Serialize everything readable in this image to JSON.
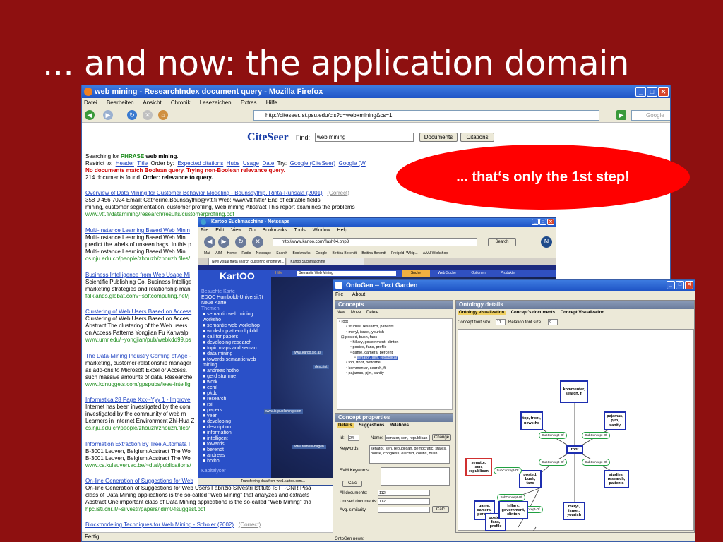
{
  "slide": {
    "title": "... and now: the application domain"
  },
  "callout": {
    "text": "... that‘s only the 1st step!"
  },
  "firefox": {
    "title": "web mining - ResearchIndex document query - Mozilla Firefox",
    "menu": [
      "Datei",
      "Bearbeiten",
      "Ansicht",
      "Chronik",
      "Lesezeichen",
      "Extras",
      "Hilfe"
    ],
    "url": "http://citeseer.ist.psu.edu/cis?q=web+mining&cs=1",
    "search_placeholder": "Google",
    "status": "Fertig"
  },
  "citeseer": {
    "logo": "CiteSeer",
    "find_label": "Find:",
    "query": "web mining",
    "documents_btn": "Documents",
    "citations_btn": "Citations",
    "search_prefix": "Searching for",
    "search_phrase": "PHRASE",
    "search_query": "web mining",
    "restrict": {
      "label": "Restrict to:",
      "links": [
        "Header",
        "Title"
      ],
      "order_label": "Order by:",
      "order_links": [
        "Expected citations",
        "Hubs",
        "Usage",
        "Date"
      ],
      "try_label": "Try:",
      "try_links": [
        "Google (CiteSeer)",
        "Google (W"
      ]
    },
    "no_docs": "No documents match Boolean query. Trying non-Boolean relevance query.",
    "found": "214 documents found.",
    "found_order": "Order: relevance to query.",
    "results": [
      {
        "title": "Overview of Data Mining for Customer Behavior Modeling - Bounsaythip, Rinta-Runsala (2001)",
        "correct": "(Correct)",
        "lines": [
          "358 9 456 7024 Email: Catherine.Bounsaythip@vtt.fi Web: www.vtt.fi/tte/ End of editable fields",
          "mining, customer segmentation, customer profiling, Web mining Abstract This report examines the problems"
        ],
        "url": "www.vtt.fi/datamining/research/results/customerprofiling.pdf"
      },
      {
        "title": "Multi-Instance Learning Based Web Minin",
        "lines": [
          "Multi-Instance Learning Based Web Mini",
          "predict the labels of unseen bags. In this p",
          "Multi-Instance Learning Based Web Mini"
        ],
        "url": "cs.nju.edu.cn/people/zhouzh/zhouzh.files/"
      },
      {
        "title": "Business Intelligence from Web Usage Mi",
        "lines": [
          "Scientific Publishing Co. Business Intellige",
          "marketing strategies and relationship man"
        ],
        "url": "falklands.globat.com/~softcomputing.net/j"
      },
      {
        "title": "Clustering of Web Users Based on Access",
        "lines": [
          "Clustering of Web Users Based on Acces",
          "Abstract The clustering of the Web users",
          "on Access Patterns Yongjian Fu Kanwalp"
        ],
        "url": "www.umr.edu/~yongjian/pub/webkdd99.ps"
      },
      {
        "title": "The Data-Mining Industry Coming of Age -",
        "lines": [
          "marketing, customer-relationship manager",
          "as add-ons to Microsoft Excel or Access.",
          "such massive amounts of data. Researche"
        ],
        "url": "www.kdnuggets.com/gpspubs/ieee-intellig"
      },
      {
        "title": "Informatica 28 Page Xxx--Yyy 1 - Improve",
        "lines": [
          "Internet has been investigated by the comi",
          "investigated by the community of web m",
          "Learners in Internet Environment Zhi-Hua Z"
        ],
        "url": "cs.nju.edu.cn/people/zhouzh/zhouzh.files/"
      },
      {
        "title": "Information Extraction By Tree Automata I",
        "lines": [
          "B-3001 Leuven, Belgium Abstract The Wo",
          "B-3001 Leuven, Belgium Abstract The Wo"
        ],
        "url": "www.cs.kuleuven.ac.be/~dtai/publications/"
      },
      {
        "title": "On-line Generation of Suggestions for Web",
        "lines": [
          "On-line Generation of Suggestions for Web Users Fabrizio Silvestri Istituto ISTI -CNR Pisa",
          "class of Data Mining applications is the so-called \"Web Mining\" that analyzes and extracts",
          "Abstract One important class of Data Mining applications is the so-called \"Web Mining\" tha"
        ],
        "url": "hpc.isti.cnr.it/~silvestr/papers/jdim04suggest.pdf"
      },
      {
        "title": "Blockmodeling Techniques for Web Mining - Schoier (2002)",
        "correct": "(Correct)",
        "lines": [],
        "url": ""
      }
    ]
  },
  "netscape": {
    "title": "Kartoo Suchmaschine - Netscape",
    "menu": [
      "File",
      "Edit",
      "View",
      "Go",
      "Bookmarks",
      "Tools",
      "Window",
      "Help"
    ],
    "url": "http://www.kartoo.com/flash04.php3",
    "search_btn": "Search",
    "bookmarks": [
      "Mail",
      "AIM",
      "Home",
      "Radio",
      "Netscape",
      "Search",
      "Bookmarks",
      "Google",
      "Bettina Berendt",
      "Bettina Berendt",
      "Freigeld -Wikip...",
      "AAAI Workshop"
    ],
    "tabs": [
      "New visual meta search clustering engine wi...",
      "Kartoo Suchmaschine"
    ],
    "logo": "KartOO",
    "kar_tabs": [
      "Hilfe",
      "Semantic Web Mining",
      "Suche",
      "Web Suche",
      "Optionen",
      "Produkte"
    ],
    "side_header": "Besuchte Karte",
    "side_items_top": [
      "EDOC Humboldt-Universit?t",
      "Neue Karte"
    ],
    "themen": "Themen",
    "topics": [
      "semantic web mining worksho",
      "semantic web workshop",
      "workshop at ecml pkdd",
      "call for papers",
      "developing research",
      "topic maps and seman",
      "data mining",
      "towards semantic web mining",
      "andreas hotho",
      "gerd stumme",
      "work",
      "ecml",
      "pkdd",
      "research",
      "rsil",
      "papers",
      "year",
      "developing",
      "description",
      "information",
      "intelligent",
      "towards",
      "berendt",
      "andreas",
      "hotho"
    ],
    "kapital": "Kapitalyser",
    "status": "Transferring data from ww1.kartoo.com...",
    "map_labels": [
      "www.karoo.sig.as",
      "descript",
      "www.fernuni-hagen.",
      "www.is-publishing.com"
    ]
  },
  "ontogen": {
    "title": "OntoGen -- Text Garden",
    "menu": [
      "File",
      "About"
    ],
    "concepts": {
      "header": "Concepts",
      "toolbar": [
        "New",
        "Move",
        "Delete"
      ],
      "tree": [
        "root",
        "studies, research, patients",
        "meryl, israel, yourish",
        "posted, bush, fans",
        "hillary, government, clinton",
        "posted, fans, profile",
        "game, camera, percent",
        "senator, sen, republican",
        "top, front, newsthe",
        "kommentar, search, fi",
        "pajamas, pjm, sanity"
      ]
    },
    "props": {
      "header": "Concept properties",
      "tabs": [
        "Details",
        "Suggestions",
        "Relations"
      ],
      "id_label": "Id:",
      "id": "24",
      "name_label": "Name:",
      "name": "senator, sen, republican",
      "change_btn": "Change",
      "keywords_label": "Keywords:",
      "keywords": "senator, sen, republican, democratic, states, house, congress, elected, collins, bush",
      "svm_label": "SVM Keywords:",
      "calc_btn": "Calc",
      "all_docs_label": "All documents:",
      "all_docs": "112",
      "unused_label": "Unused documents:",
      "unused": "112",
      "avg_label": "Avg. similarity:",
      "calc2_btn": "Calc"
    },
    "details": {
      "header": "Ontology details",
      "tabs": [
        "Ontology visualization",
        "Concept's documents",
        "Concept Visualization"
      ],
      "font_label": "Concept font size:",
      "font_size": "11",
      "rel_label": "Relation font size",
      "rel_size": "9"
    },
    "graph": {
      "root": "root",
      "subconcept": "SubConcept-Of",
      "nodes": [
        "kommentar, search, fi",
        "top, front, newsthe",
        "pajamas, pjm, sanity",
        "senator, sen, republican",
        "posted, bush, fans",
        "studies, research, patients",
        "game, camera, percent",
        "meryl, israel, yourish",
        "posted, fans, profile",
        "hillary, government, clinton"
      ]
    },
    "status": "OntoGen news:"
  }
}
